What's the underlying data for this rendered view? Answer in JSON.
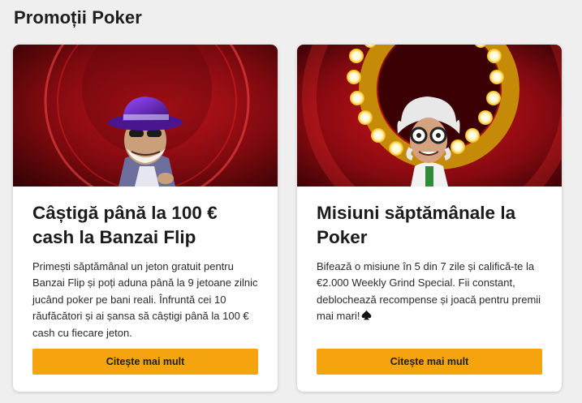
{
  "page": {
    "title": "Promoții Poker"
  },
  "promotions": [
    {
      "title": "Câștigă până la 100 € cash la Banzai Flip",
      "description": "Primești săptămânal un jeton gratuit pentru Banzai Flip și poți aduna până la 9 jetoane zilnic jucând poker pe bani reali. Înfruntă cei 10 răufăcători și ai șansa să câștigi până la 100 € cash cu fiecare jeton.",
      "button_label": "Citește mai mult",
      "image_icon": "villain-purple-hat-illustration"
    },
    {
      "title": "Misiuni săptămânale la Poker",
      "description": "Bifează o misiune în 5 din 7 zile și califică-te la €2.000 Weekly Grind Special. Fii constant, deblochează recompense și joacă pentru premii mai mari!",
      "button_label": "Citește mai mult",
      "image_icon": "mad-scientist-illustration",
      "trailing_icon": "spade-icon"
    }
  ],
  "colors": {
    "background": "#efefef",
    "button": "#f5a30e",
    "card_image_red": "#8a0a10"
  }
}
